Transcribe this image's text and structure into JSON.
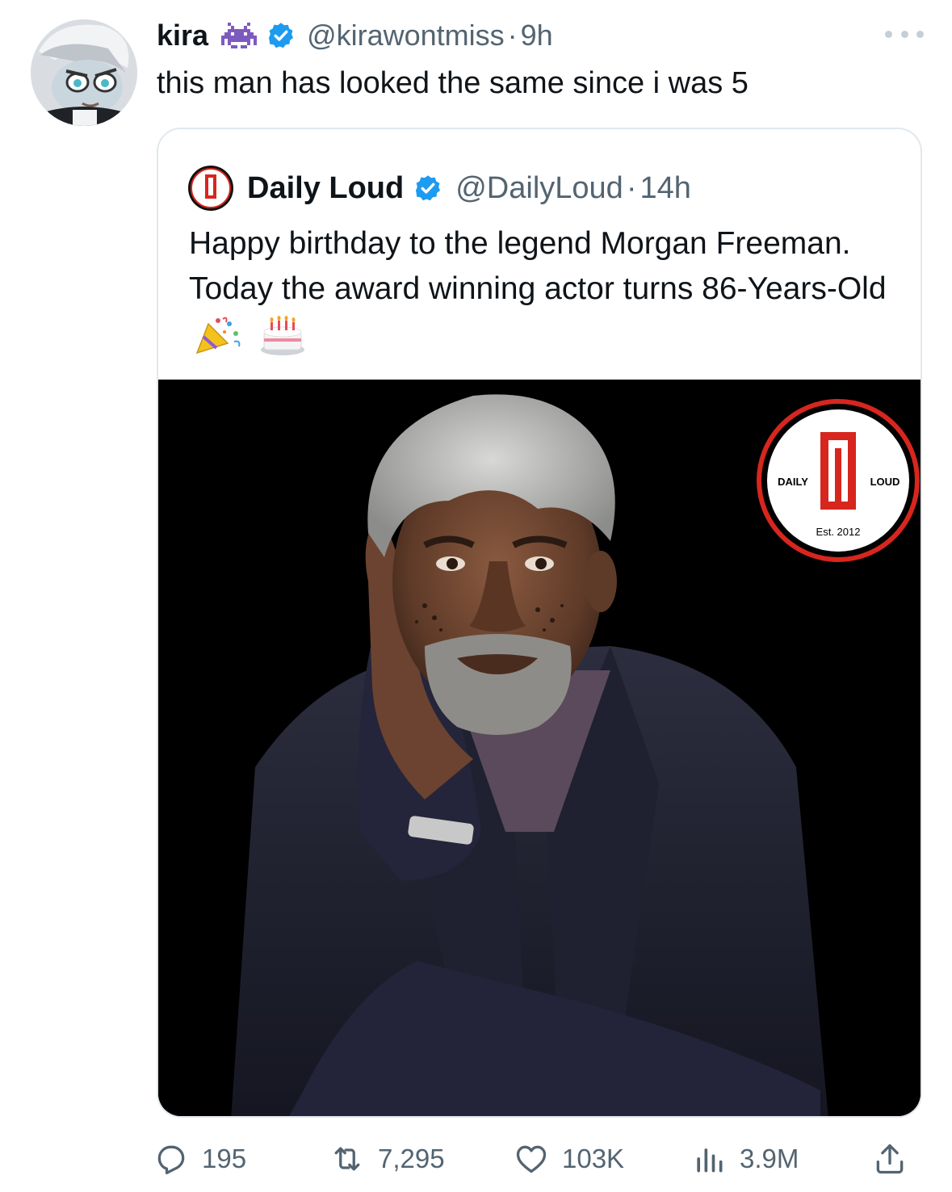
{
  "author": {
    "name": "kira",
    "handle": "@kirawontmiss",
    "time": "9h",
    "badge_icon": "space-invader-icon",
    "verified": true
  },
  "tweet": {
    "text": "this man has looked the same since i was 5"
  },
  "quoted": {
    "name": "Daily Loud",
    "handle": "@DailyLoud",
    "time": "14h",
    "verified": true,
    "text": "Happy birthday to the legend Morgan Freeman. Today the award winning actor turns 86-Years-Old",
    "emojis": [
      "party-popper-icon",
      "birthday-cake-icon"
    ],
    "logo": {
      "left_word": "DAILY",
      "right_word": "LOUD",
      "est": "Est. 2012",
      "monogram": "DL"
    }
  },
  "actions": {
    "replies": "195",
    "retweets": "7,295",
    "likes": "103K",
    "views": "3.9M"
  },
  "colors": {
    "text": "#0f1419",
    "secondary": "#536471",
    "verified_blue": "#1d9bf0",
    "brand_red": "#d7261e"
  }
}
